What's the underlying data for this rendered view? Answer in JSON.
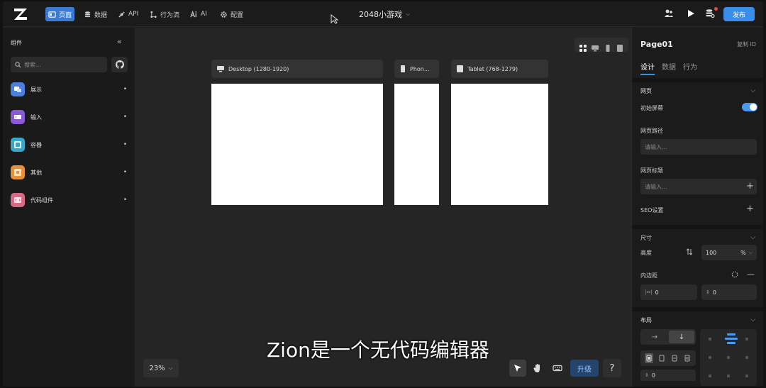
{
  "topbar": {
    "nav": [
      {
        "label": "页面",
        "icon": "page-icon"
      },
      {
        "label": "数据",
        "icon": "database-icon"
      },
      {
        "label": "API",
        "icon": "api-icon"
      },
      {
        "label": "行为流",
        "icon": "flow-icon"
      },
      {
        "label": "AI",
        "icon": "ai-icon"
      },
      {
        "label": "配置",
        "icon": "gear-icon"
      }
    ],
    "project_title": "2048小游戏",
    "publish_label": "发布"
  },
  "left": {
    "title": "组件",
    "search_placeholder": "搜索...",
    "categories": [
      {
        "label": "展示",
        "color": "#4a7fe0"
      },
      {
        "label": "输入",
        "color": "#8a5ad8"
      },
      {
        "label": "容器",
        "color": "#3aa6c8"
      },
      {
        "label": "其他",
        "color": "#e6913a"
      },
      {
        "label": "代码组件",
        "color": "#d86a86"
      }
    ],
    "bullet": "•"
  },
  "canvas": {
    "frames": [
      {
        "label": "Desktop (1280-1920)"
      },
      {
        "label": "Phon..."
      },
      {
        "label": "Tablet (768-1279)"
      }
    ],
    "zoom": "23%",
    "upgrade_label": "升级",
    "help": "?",
    "subtitle": "Zion是一个无代码编辑器"
  },
  "right": {
    "page_name": "Page01",
    "copy_id": "复制 ID",
    "tabs": [
      "设计",
      "数据",
      "行为"
    ],
    "section_webpage": "网页",
    "initial_screen": "初始屏幕",
    "page_path_label": "网页路径",
    "page_path_placeholder": "请输入...",
    "page_title_label": "网页标题",
    "page_title_placeholder": "请输入...",
    "seo_label": "SEO设置",
    "section_size": "尺寸",
    "height_label": "高度",
    "height_value": "100",
    "height_unit": "%",
    "padding_label": "内边距",
    "padding_h": "0",
    "padding_v": "0",
    "section_layout": "布局",
    "padding_bottom_value": "0"
  }
}
